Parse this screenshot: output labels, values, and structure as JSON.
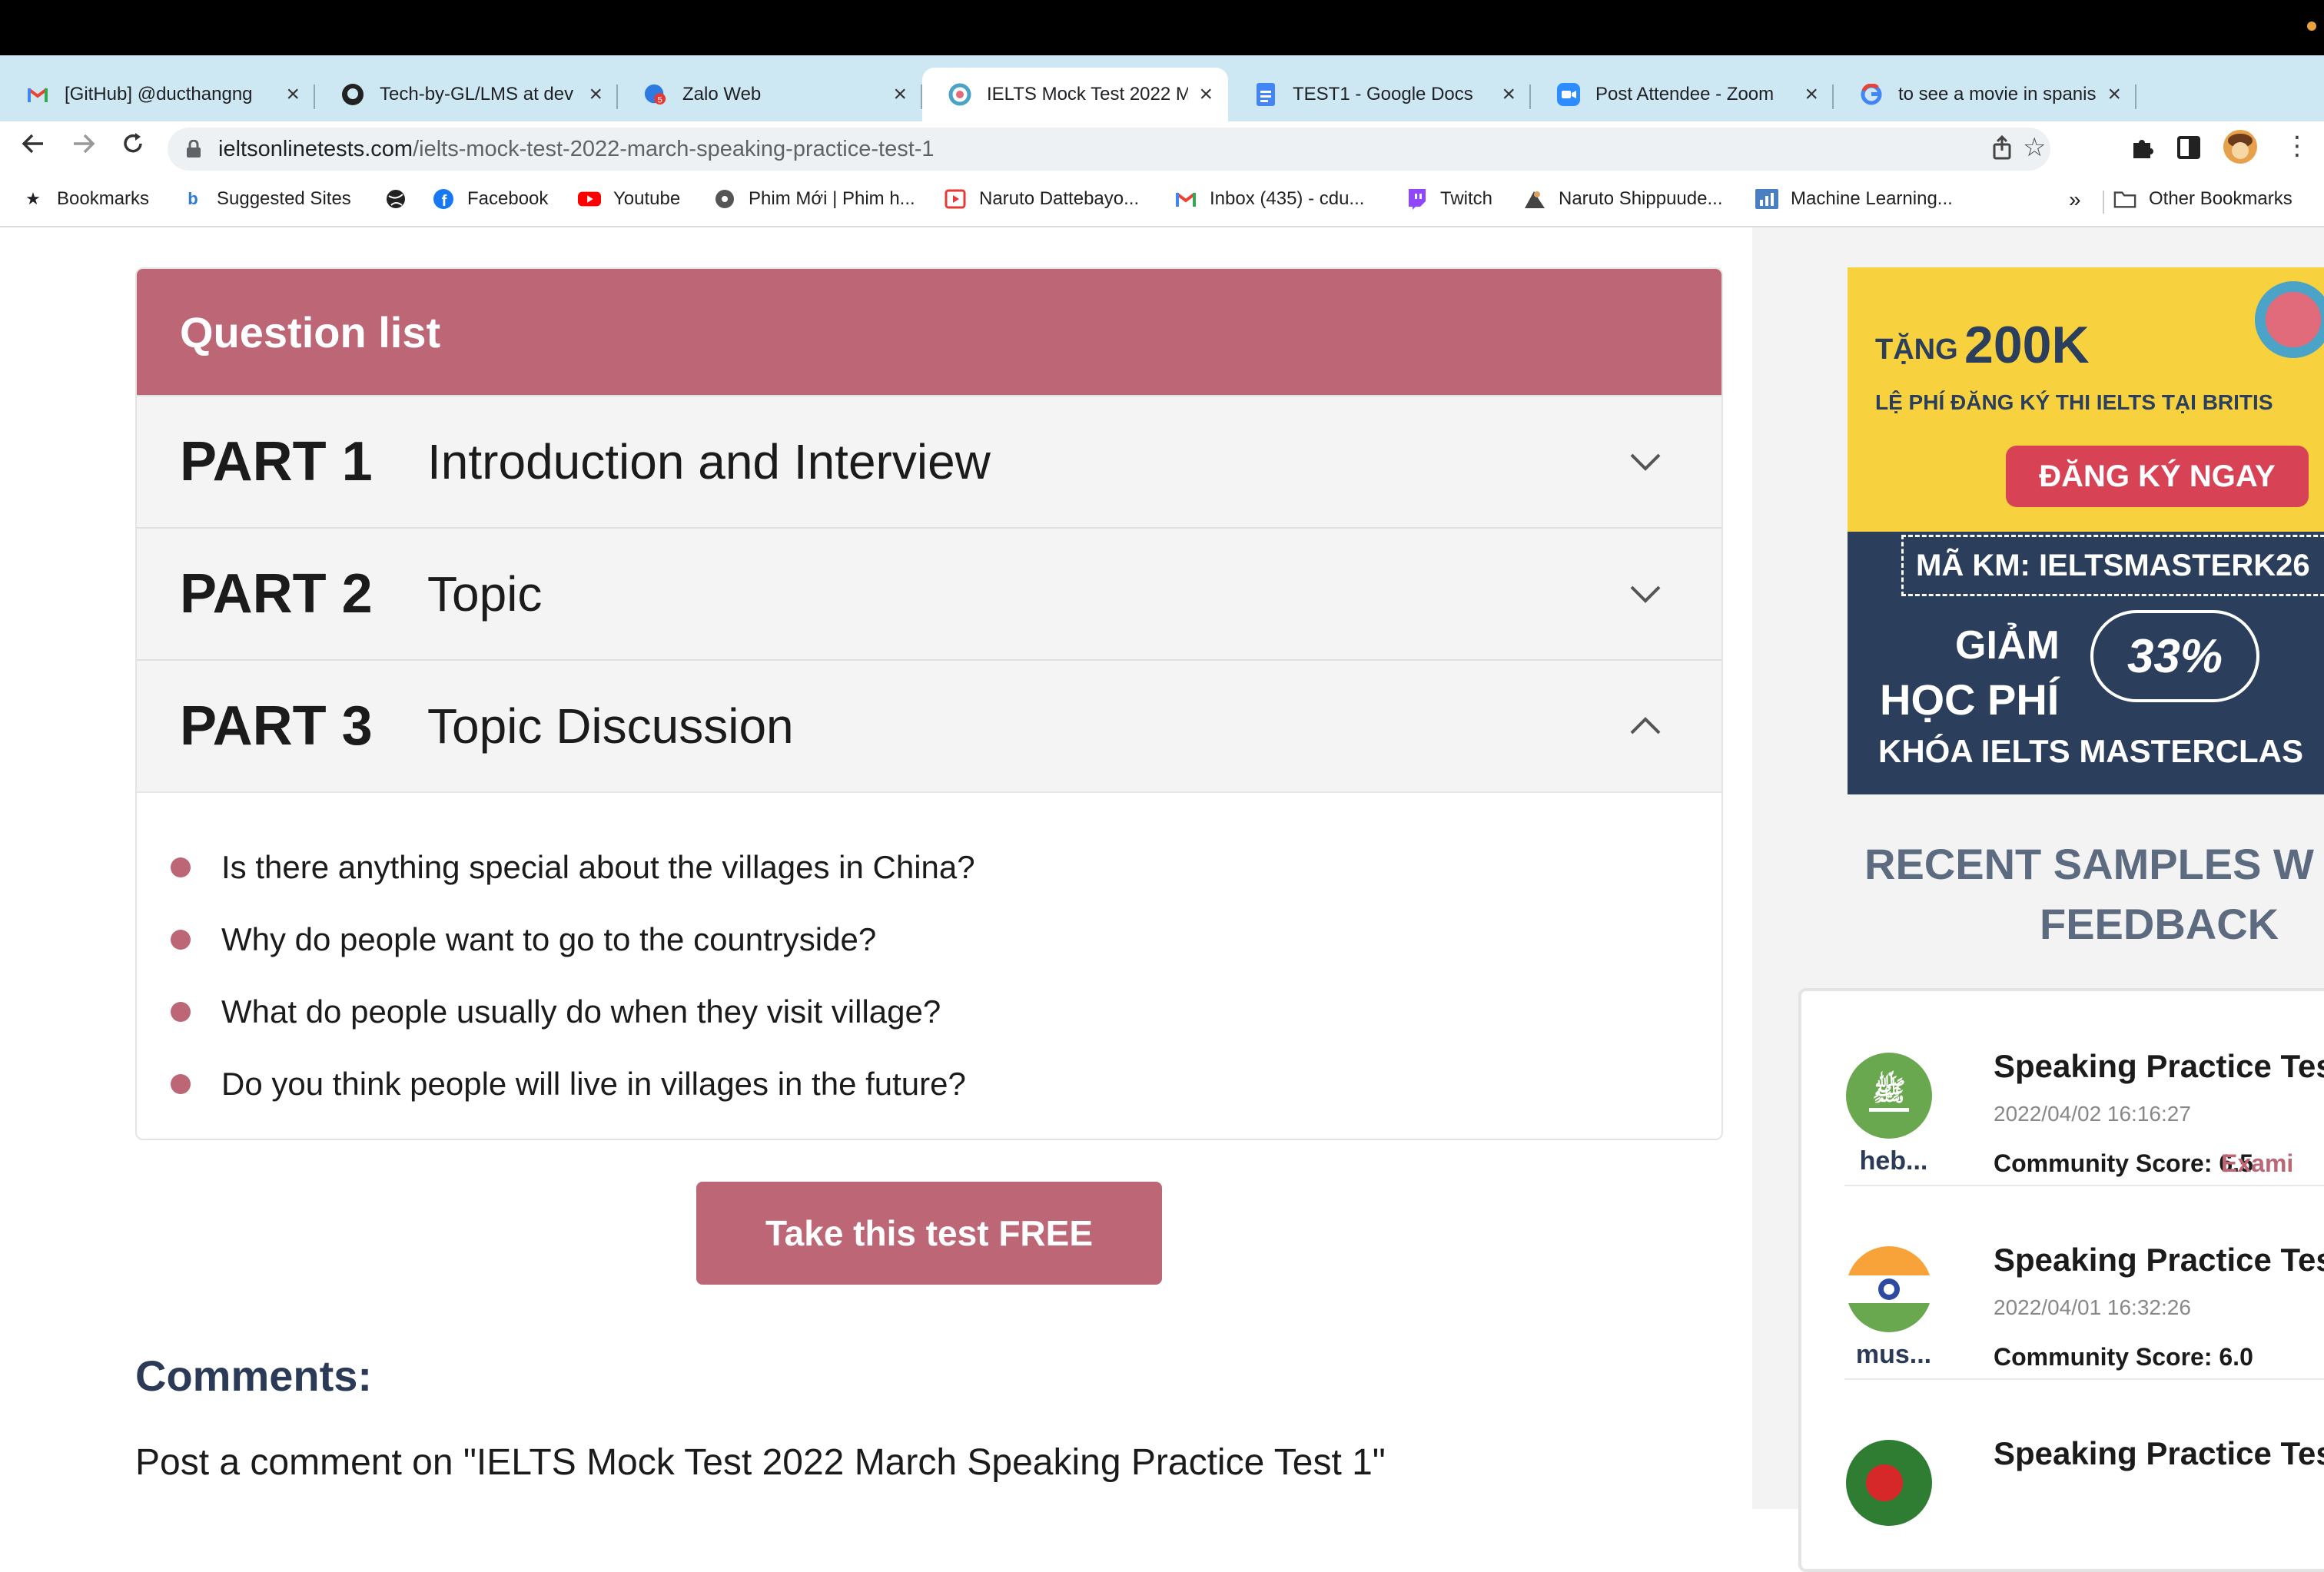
{
  "browser": {
    "tabs": [
      {
        "title": "[GitHub] @ducthangng",
        "icon": "gmail-icon"
      },
      {
        "title": "Tech-by-GL/LMS at dev",
        "icon": "github-icon"
      },
      {
        "title": "Zalo Web",
        "icon": "zalo-icon",
        "badge": "5"
      },
      {
        "title": "IELTS Mock Test 2022 M",
        "icon": "ielts-icon",
        "active": true
      },
      {
        "title": "TEST1 - Google Docs",
        "icon": "docs-icon"
      },
      {
        "title": "Post Attendee - Zoom",
        "icon": "zoom-icon"
      },
      {
        "title": "to see a movie in spanis",
        "icon": "google-icon"
      }
    ],
    "new_tab_label": "+",
    "url_host": "ieltsonlinetests.com",
    "url_path": "/ielts-mock-test-2022-march-speaking-practice-test-1",
    "bookmarks": [
      {
        "label": "Bookmarks",
        "icon": "star-icon"
      },
      {
        "label": "Suggested Sites",
        "icon": "bing-icon"
      },
      {
        "label": "",
        "icon": "globe-icon"
      },
      {
        "label": "Facebook",
        "icon": "facebook-icon"
      },
      {
        "label": "Youtube",
        "icon": "youtube-icon"
      },
      {
        "label": "Phim Mới | Phim h...",
        "icon": "film-icon"
      },
      {
        "label": "Naruto Dattebayo...",
        "icon": "play-icon"
      },
      {
        "label": "Inbox (435) - cdu...",
        "icon": "gmail-icon"
      },
      {
        "label": "Twitch",
        "icon": "twitch-icon"
      },
      {
        "label": "Naruto Shippuude...",
        "icon": "naruto-icon"
      },
      {
        "label": "Machine Learning...",
        "icon": "ml-icon"
      }
    ],
    "bookmarks_overflow": "»",
    "other_bookmarks": "Other Bookmarks"
  },
  "question_list": {
    "heading": "Question list",
    "parts": [
      {
        "number": "PART 1",
        "title": "Introduction and Interview",
        "expanded": false
      },
      {
        "number": "PART 2",
        "title": "Topic",
        "expanded": false
      },
      {
        "number": "PART 3",
        "title": "Topic Discussion",
        "expanded": true
      }
    ],
    "questions": [
      "Is there anything special about the villages in China?",
      "Why do people want to go to the countryside?",
      "What do people usually do when they visit village?",
      "Do you think people will live in villages in the future?"
    ]
  },
  "cta_label": "Take this test FREE",
  "comments": {
    "heading": "Comments:",
    "post_prompt": "Post a comment on \"IELTS Mock Test 2022 March Speaking Practice Test 1\""
  },
  "ad": {
    "line1_small": "TẶNG",
    "line1_big": "200K",
    "line2": "LỆ PHÍ ĐĂNG KÝ THI IELTS TẠI BRITIS",
    "button": "ĐĂNG KÝ NGAY",
    "code": "MÃ KM: IELTSMASTERK26",
    "giam": "GIẢM",
    "percent": "33%",
    "hoc_phi": "HỌC PHÍ",
    "khoa": "KHÓA IELTS MASTERCLAS"
  },
  "recent": {
    "line1": "RECENT SAMPLES W",
    "line2": "FEEDBACK"
  },
  "samples": [
    {
      "title": "Speaking Practice Test",
      "date": "2022/04/02 16:16:27",
      "user": "heb...",
      "score": "Community Score: 6.5",
      "exam": "Exami",
      "flag": "saudi-flag-icon"
    },
    {
      "title": "Speaking Practice Test",
      "date": "2022/04/01 16:32:26",
      "user": "mus...",
      "score": "Community Score: 6.0",
      "exam": "",
      "flag": "india-flag-icon"
    },
    {
      "title": "Speaking Practice Test",
      "date": "",
      "user": "",
      "score": "",
      "exam": "",
      "flag": "bangladesh-flag-icon"
    }
  ],
  "colors": {
    "accent": "#bc6676",
    "heading_dark": "#2b3b57",
    "tab_strip": "#cde7f3"
  }
}
